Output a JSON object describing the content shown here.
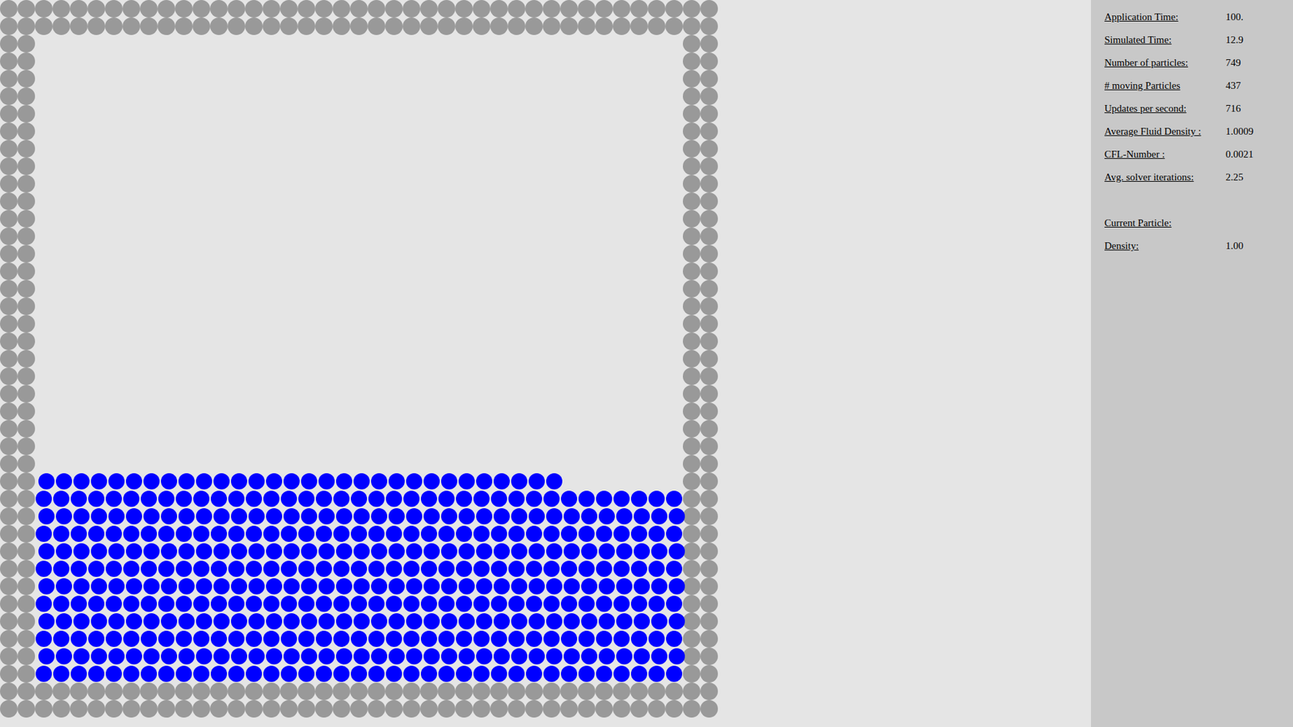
{
  "simulation": {
    "wall_color": "#999999",
    "fluid_color": "#0000ff"
  },
  "stats": [
    {
      "label": "Application Time:",
      "value": "100."
    },
    {
      "label": "Simulated Time:",
      "value": "12.9"
    },
    {
      "label": "Number of particles:",
      "value": "749"
    },
    {
      "label": "# moving Particles",
      "value": "437"
    },
    {
      "label": "Updates per second:",
      "value": "716"
    },
    {
      "label": "Average Fluid Density :",
      "value": "1.0009"
    },
    {
      "label": "CFL-Number :",
      "value": "0.0021"
    },
    {
      "label": "Avg. solver iterations:",
      "value": "2.25"
    }
  ],
  "current_particle": {
    "title": "Current Particle:",
    "rows": [
      {
        "label": "Density:",
        "value": "1.00"
      }
    ]
  }
}
